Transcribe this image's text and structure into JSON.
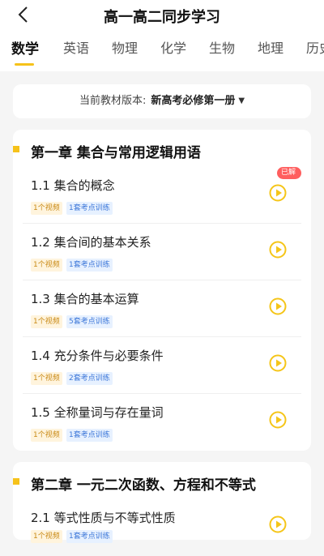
{
  "header": {
    "title": "高一高二同步学习"
  },
  "tabs": [
    "数学",
    "英语",
    "物理",
    "化学",
    "生物",
    "地理",
    "历史"
  ],
  "version": {
    "label": "当前教材版本:",
    "value": "新高考必修第一册"
  },
  "chapters": [
    {
      "title": "第一章 集合与常用逻辑用语",
      "lessons": [
        {
          "title": "1.1 集合的概念",
          "video": "1个视频",
          "train": "1套考点训练",
          "badge": "已解锁"
        },
        {
          "title": "1.2 集合间的基本关系",
          "video": "1个视频",
          "train": "1套考点训练"
        },
        {
          "title": "1.3 集合的基本运算",
          "video": "1个视频",
          "train": "5套考点训练"
        },
        {
          "title": "1.4 充分条件与必要条件",
          "video": "1个视频",
          "train": "2套考点训练"
        },
        {
          "title": "1.5 全称量词与存在量词",
          "video": "1个视频",
          "train": "1套考点训练"
        }
      ]
    },
    {
      "title": "第二章 一元二次函数、方程和不等式",
      "lessons": [
        {
          "title": "2.1 等式性质与不等式性质",
          "video": "1个视频",
          "train": "1套考点训练"
        }
      ]
    }
  ]
}
